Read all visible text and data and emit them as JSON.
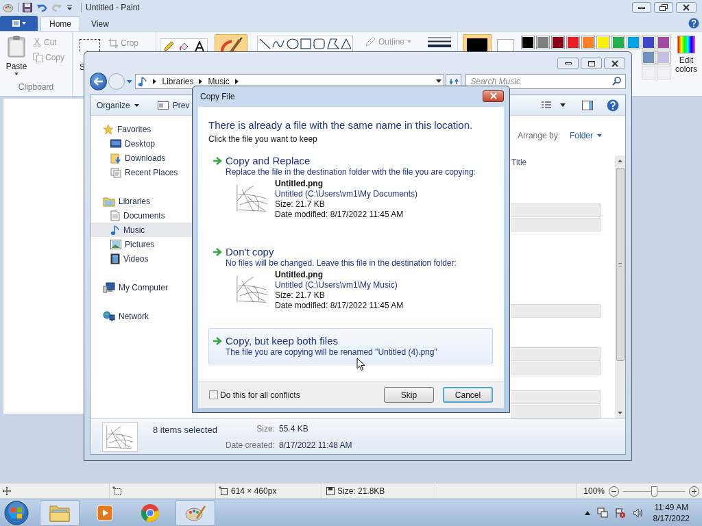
{
  "paint": {
    "title": "Untitled - Paint",
    "tabs": [
      {
        "label": "Home",
        "selected": true
      },
      {
        "label": "View",
        "selected": false
      }
    ],
    "clipboard": {
      "paste": "Paste",
      "cut": "Cut",
      "copy": "Copy",
      "label": "Clipboard"
    },
    "image": {
      "select": "S",
      "crop": "Crop"
    },
    "outline": "Outline",
    "palette": [
      {
        "color": "#000000"
      },
      {
        "color": "#7f7f7f"
      },
      {
        "color": "#880015"
      },
      {
        "color": "#ed1c24"
      },
      {
        "color": "#ff7f27"
      },
      {
        "color": "#fff200"
      },
      {
        "color": "#22b14c"
      },
      {
        "color": "#00a2e8"
      },
      {
        "color": "#3f48cc"
      },
      {
        "color": "#a349a4"
      }
    ],
    "palette_row2": [
      {
        "color": "#7092be"
      },
      {
        "color": "#c8bfe7"
      }
    ],
    "edit_colors": "Edit colors",
    "status": {
      "dimensions": "614 × 460px",
      "size": "Size: 21.8KB",
      "zoom": "100%",
      "zoom_slider": {
        "level": 0.5
      }
    }
  },
  "explorer": {
    "breadcrumb": [
      "Libraries",
      "Music"
    ],
    "search_placeholder": "Search Music",
    "toolbar": [
      "Organize",
      "Prev"
    ],
    "nav": [
      {
        "label": "Favorites",
        "kind": "star",
        "selected": false,
        "children": [
          {
            "label": "Desktop",
            "kind": "desktop",
            "selected": false
          },
          {
            "label": "Downloads",
            "kind": "downloads",
            "selected": false
          },
          {
            "label": "Recent Places",
            "kind": "recent",
            "selected": false
          }
        ]
      },
      {
        "label": "Libraries",
        "kind": "library",
        "selected": false,
        "children": [
          {
            "label": "Documents",
            "kind": "document",
            "selected": false
          },
          {
            "label": "Music",
            "kind": "music",
            "selected": true
          },
          {
            "label": "Pictures",
            "kind": "pictures",
            "selected": false
          },
          {
            "label": "Videos",
            "kind": "videos",
            "selected": false
          }
        ]
      },
      {
        "label": "My Computer",
        "kind": "computer",
        "selected": false
      },
      {
        "label": "Network",
        "kind": "network",
        "selected": false
      }
    ],
    "arrange_label": "Arrange by:",
    "arrange_value": "Folder",
    "column": "Title",
    "rows": [
      {
        "selected": false
      },
      {
        "selected": false
      },
      {
        "selected": true
      },
      {
        "selected": true
      },
      {
        "selected": false
      },
      {
        "selected": false
      },
      {
        "selected": false
      },
      {
        "selected": false
      },
      {
        "selected": false
      },
      {
        "selected": true
      },
      {
        "selected": false
      },
      {
        "selected": false
      },
      {
        "selected": true
      },
      {
        "selected": true
      },
      {
        "selected": false
      },
      {
        "selected": true
      },
      {
        "selected": true
      }
    ],
    "details": {
      "count": "8 items selected",
      "size_label": "Size:",
      "size": "55.4 KB",
      "date_label": "Date created:",
      "date": "8/17/2022 11:48 AM"
    }
  },
  "dialog": {
    "title": "Copy File",
    "heading": "There is already a file with the same name in this location.",
    "subheading": "Click the file you want to keep",
    "options": [
      {
        "kind": "file",
        "title": "Copy and Replace",
        "description": "Replace the file in the destination folder with the file you are copying:",
        "hovered": false,
        "file": {
          "name": "Untitled.png",
          "location": "Untitled (C:\\Users\\vm1\\My Documents)",
          "size": "Size: 21.7 KB",
          "date": "Date modified: 8/17/2022 11:45 AM"
        }
      },
      {
        "kind": "file",
        "title": "Don't copy",
        "description": "No files will be changed. Leave this file in the destination folder:",
        "hovered": false,
        "file": {
          "name": "Untitled.png",
          "location": "Untitled (C:\\Users\\vm1\\My Music)",
          "size": "Size: 21.7 KB",
          "date": "Date modified: 8/17/2022 11:45 AM"
        }
      },
      {
        "kind": "plain",
        "title": "Copy, but keep both files",
        "description": "The file you are copying will be renamed \"Untitled (4).png\"",
        "hovered": true
      }
    ],
    "checkbox": {
      "label": "Do this for all conflicts",
      "checked": false
    },
    "buttons": [
      {
        "label": "Skip",
        "default": false
      },
      {
        "label": "Cancel",
        "default": true
      }
    ]
  },
  "taskbar": {
    "apps": [
      {
        "kind": "explorer",
        "active": true
      },
      {
        "kind": "media",
        "active": false
      },
      {
        "kind": "chrome",
        "active": false
      },
      {
        "kind": "paint",
        "active": true
      }
    ],
    "time": "11:49 AM",
    "date": "8/17/2022"
  }
}
